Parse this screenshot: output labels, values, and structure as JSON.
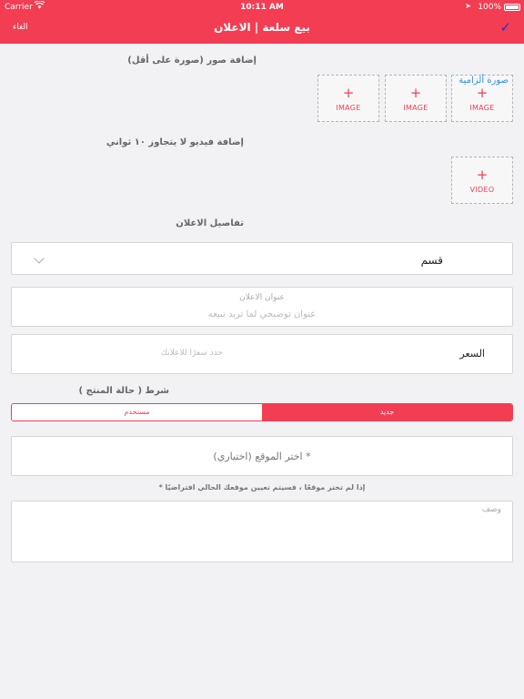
{
  "status_bar": {
    "carrier": "Carrier",
    "time": "10:11 AM",
    "battery": "100%"
  },
  "nav": {
    "cancel": "الغاء",
    "title": "بيع سلعة | الاعلان"
  },
  "photos": {
    "label": "إضافة صور (صورة على أقل)",
    "items": [
      {
        "plus": "+",
        "label": "IMAGE"
      },
      {
        "plus": "+",
        "label": "IMAGE"
      },
      {
        "plus": "+",
        "label": "IMAGE",
        "tag": "صورة ألزامية"
      }
    ]
  },
  "video": {
    "label": "إضافة فيديو لا يتجاوز ١٠ ثواني",
    "plus": "+",
    "button": "VIDEO"
  },
  "details": {
    "label": "تفاصيل الاعلان",
    "category": "قسم",
    "title_label": "عنوان الاعلان",
    "title_placeholder": "عنوان توضيحي لما تريد تبيعه",
    "price_label": "السعر",
    "price_placeholder": "حدد سعرًا للاعلانك"
  },
  "condition": {
    "label": "شرط ( حالة المنتج )",
    "new": "جديد",
    "used": "مستخدم",
    "selected": "جديد"
  },
  "location": {
    "placeholder": "اختر الموقع (اختياري) *",
    "note": "* إذا لم تختر موقعًا ، فسيتم تعيين موقعك الحالي افتراضيًا"
  },
  "description": {
    "placeholder": "وصف"
  },
  "colors": {
    "accent": "#f33d52",
    "check": "#2633c9",
    "required_tag": "#2f8fe6"
  }
}
